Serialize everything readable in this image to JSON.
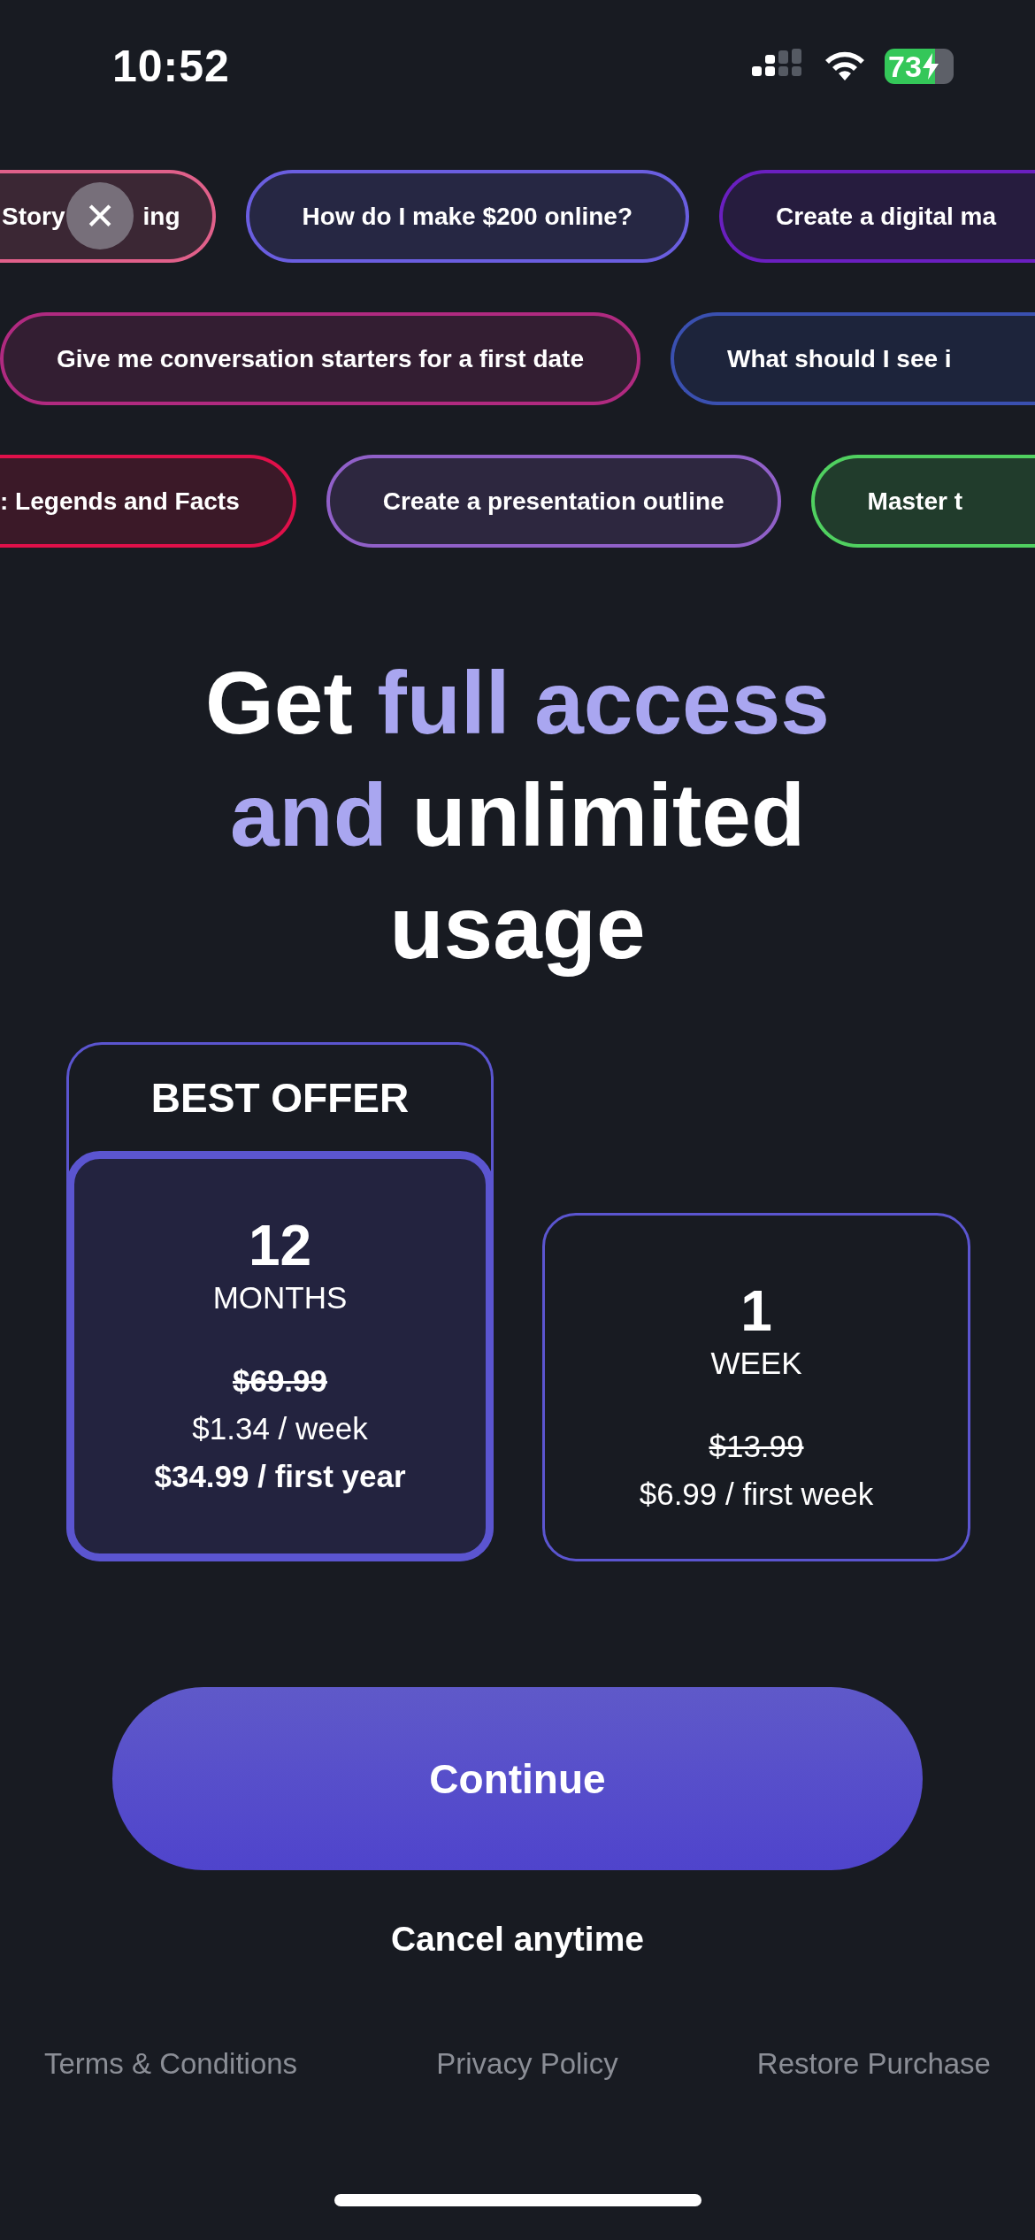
{
  "status_bar": {
    "time": "10:52",
    "battery": "73"
  },
  "close_button": {
    "label": "✕"
  },
  "suggestion_rows": [
    {
      "chips": [
        {
          "text": "Story",
          "text_after": "ing",
          "color": "#e0608a"
        },
        {
          "text": "How do I make $200 online?",
          "color": "#6a5ee0"
        },
        {
          "text": "Create a digital ma",
          "color": "#6a1fc0"
        }
      ]
    },
    {
      "chips": [
        {
          "text": "Give me conversation starters for a first date",
          "color": "#b02a80"
        },
        {
          "text": "What should I see i",
          "color": "#3a50b0"
        }
      ]
    },
    {
      "chips": [
        {
          "text": ": Legends and Facts",
          "color": "#e0104a"
        },
        {
          "text": "Create a presentation outline",
          "color": "#9060c8"
        },
        {
          "text": "Master t",
          "color": "#50d060"
        }
      ]
    }
  ],
  "headline": [
    {
      "text": "Get ",
      "accent": false
    },
    {
      "text": "full access and",
      "accent": true
    },
    {
      "text": " unlimited usage",
      "accent": false
    }
  ],
  "plans": [
    {
      "badge": "BEST OFFER",
      "selected": true,
      "count": "12",
      "unit": "MONTHS",
      "lines": [
        {
          "text": "$69.99",
          "kind": "strike"
        },
        {
          "text": "$1.34 / week",
          "kind": "regular"
        },
        {
          "text": "$34.99 / first year",
          "kind": "bold"
        }
      ]
    },
    {
      "selected": false,
      "count": "1",
      "unit": "WEEK",
      "lines": [
        {
          "text": "$13.99",
          "kind": "strike"
        },
        {
          "text": "$6.99 / first week",
          "kind": "regular"
        }
      ]
    }
  ],
  "continue_button": {
    "label": "Continue"
  },
  "note": "Cancel anytime",
  "footer_links": [
    "Terms & Conditions",
    "Privacy Policy",
    "Restore Purchase"
  ]
}
